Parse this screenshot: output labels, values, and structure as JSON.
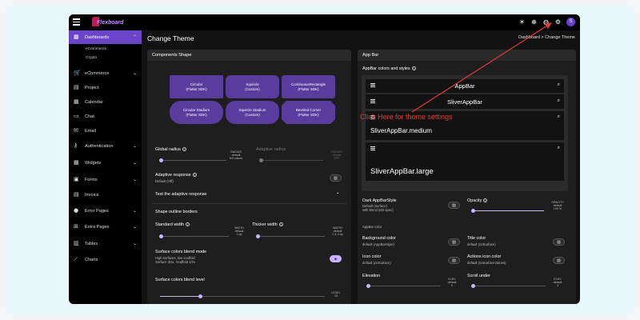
{
  "app": {
    "logo_text": "Flexboard"
  },
  "topbar": {
    "avatar_letter": "S"
  },
  "sidebar": {
    "items": [
      {
        "label": "Dashboards",
        "icon": "grid-icon"
      },
      {
        "label": "eCommerce",
        "icon": "cart-icon"
      },
      {
        "label": "Project",
        "icon": "project-icon"
      },
      {
        "label": "Calendar",
        "icon": "calendar-icon"
      },
      {
        "label": "Chat",
        "icon": "chat-icon"
      },
      {
        "label": "Email",
        "icon": "email-icon"
      },
      {
        "label": "Authentication",
        "icon": "key-icon"
      },
      {
        "label": "Widgets",
        "icon": "widgets-icon"
      },
      {
        "label": "Forms",
        "icon": "forms-icon"
      },
      {
        "label": "Invoice",
        "icon": "invoice-icon"
      },
      {
        "label": "Error Pages",
        "icon": "error-icon"
      },
      {
        "label": "Extra Pages",
        "icon": "extra-icon"
      },
      {
        "label": "Tables",
        "icon": "table-icon"
      },
      {
        "label": "Charts",
        "icon": "chart-icon"
      }
    ],
    "subitems": [
      "eCommerce",
      "Crypto"
    ]
  },
  "page": {
    "title": "Change Theme",
    "breadcrumb": "Dashboard  >  Change Theme"
  },
  "components_shape": {
    "header": "Components Shape",
    "shapes": [
      {
        "name": "Circular",
        "sub": "(Flutter SDK)"
      },
      {
        "name": "Squircle",
        "sub": "(Custom)"
      },
      {
        "name": "ContinuousRectangle",
        "sub": "(Flutter SDK)"
      },
      {
        "name": "Circular Stadium",
        "sub": "(Flutter SDK)"
      },
      {
        "name": "Squircle Stadium",
        "sub": "(Custom)"
      },
      {
        "name": "Beveled Corner",
        "sub": "(Flutter SDK)"
      }
    ],
    "global_radius": {
      "label": "Global radius",
      "value_label": "RADIUS",
      "value_sub": "default",
      "value_sub2": "M3 values"
    },
    "adaptive_radius": {
      "label": "Adaptive radius",
      "value_label": "RADIUS",
      "value_sub": "default",
      "value_sub2": "OFF"
    },
    "adaptive_response": {
      "label": "Adaptive response",
      "sub": "Default (Off)"
    },
    "test_adaptive": "Test the adaptive response",
    "shape_outline": "Shape outline borders",
    "standard_width": {
      "label": "Standard width",
      "value_label": "WIDTH",
      "value_sub": "default",
      "value_sub2": "1 dp"
    },
    "thicker_width": {
      "label": "Thicker width",
      "value_label": "WIDTH",
      "value_sub": "default",
      "value_sub2": "1 & 2 dp"
    },
    "surface_blend_mode": {
      "label": "Surface colors blend mode",
      "sub": "High surfaces, low scaffold",
      "sub2": "Surface 3/2x, Scaffold 1/2x"
    },
    "surface_blend_level": {
      "label": "Surface colors blend level",
      "value_label": "LEVEL",
      "value": "10"
    }
  },
  "app_bar": {
    "header": "App Bar",
    "colors_label": "AppBar colors and styles",
    "previews": [
      "AppBar",
      "SliverAppBar",
      "SliverAppBar.medium",
      "SliverAppBar.large"
    ],
    "dark_style": {
      "label": "Dark AppBarStyle",
      "sub": "Default (surface)",
      "sub2": "with blend (M3 spec)"
    },
    "opacity": {
      "label": "Opacity",
      "value_label": "OPACITY",
      "value_sub": "default",
      "value": "100 %"
    },
    "appbar_color": "AppBar color",
    "background_color": {
      "label": "Background color",
      "sub": "default (AppBarStyle)"
    },
    "title_color": {
      "label": "Title color",
      "sub": "default (onSurface)"
    },
    "icon_color": {
      "label": "Icon color",
      "sub": "default (onSurface)"
    },
    "actions_icon_color": {
      "label": "Actions icon color",
      "sub": "default (onSurfaceVariant)"
    },
    "elevation": {
      "label": "Elevation",
      "value_label": "ELEV",
      "value_sub": "default",
      "value": "0"
    },
    "scroll_under": {
      "label": "Scroll under",
      "value_label": "ELEV",
      "value_sub": "default",
      "value": "3"
    }
  },
  "callout": {
    "text": "Click Here for theme settings",
    "color": "#e53935"
  },
  "colors": {
    "accent": "#6a45c8",
    "shape_fill": "#5a3c9e",
    "slider": "#c8b4ff"
  }
}
